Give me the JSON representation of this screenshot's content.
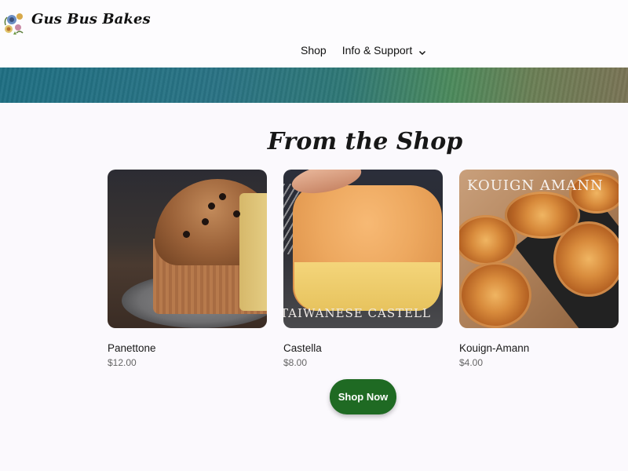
{
  "brand": {
    "name": "Gus Bus Bakes",
    "logo": "floral-logo-icon"
  },
  "nav": {
    "items": [
      {
        "label": "Shop"
      },
      {
        "label": "Info & Support",
        "icon": "chevron-down-icon"
      }
    ]
  },
  "section": {
    "title": "From the Shop"
  },
  "products": [
    {
      "name": "Panettone",
      "price": "$12.00"
    },
    {
      "name": "Castella",
      "price": "$8.00",
      "image_caption": "TAIWANESE CASTELL"
    },
    {
      "name": "Kouign-Amann",
      "price": "$4.00",
      "image_caption": "KOUIGN AMANN"
    }
  ],
  "cta": {
    "label": "Shop Now"
  },
  "colors": {
    "cta": "#1f6a23",
    "banner_start": "#1f6f83",
    "banner_end": "#7a7455",
    "page_bg": "#fbf9fd"
  }
}
